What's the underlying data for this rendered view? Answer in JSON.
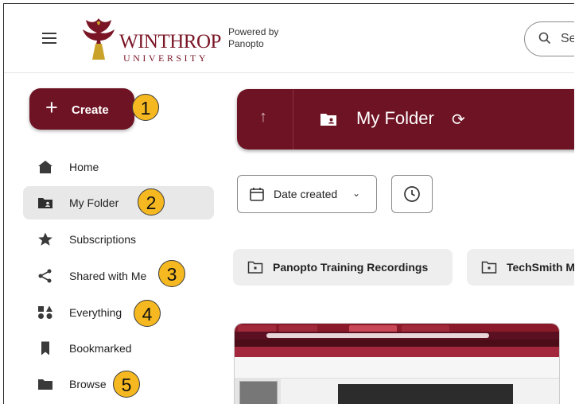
{
  "header": {
    "logo_main": "WINTHROP",
    "logo_sub": "UNIVERSITY",
    "powered_line1": "Powered by",
    "powered_line2": "Panopto",
    "search_placeholder": "Se"
  },
  "create_button": {
    "label": "Create",
    "icon": "plus-icon"
  },
  "sidebar": {
    "items": [
      {
        "label": "Home",
        "icon": "home-icon",
        "active": false
      },
      {
        "label": "My Folder",
        "icon": "folder-user-icon",
        "active": true
      },
      {
        "label": "Subscriptions",
        "icon": "star-icon",
        "active": false
      },
      {
        "label": "Shared with Me",
        "icon": "share-icon",
        "active": false
      },
      {
        "label": "Everything",
        "icon": "shapes-icon",
        "active": false
      },
      {
        "label": "Bookmarked",
        "icon": "bookmark-icon",
        "active": false
      },
      {
        "label": "Browse",
        "icon": "folder-icon",
        "active": false
      }
    ]
  },
  "callouts": [
    "1",
    "2",
    "3",
    "4",
    "5"
  ],
  "folder_bar": {
    "title": "My Folder",
    "up_icon": "arrow-up-icon",
    "refresh_icon": "refresh-icon"
  },
  "sort": {
    "label": "Date created",
    "icon": "calendar-icon",
    "clock_icon": "clock-icon"
  },
  "folders": [
    {
      "name": "Panopto Training Recordings"
    },
    {
      "name": "TechSmith M"
    }
  ],
  "colors": {
    "brand": "#6e1323",
    "callout": "#f5b820",
    "active_bg": "#e8e8e8"
  }
}
